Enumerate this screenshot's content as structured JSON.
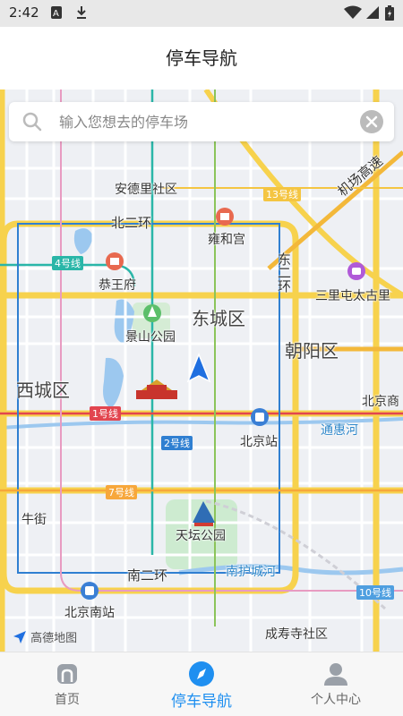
{
  "status_bar": {
    "time": "2:42"
  },
  "header": {
    "title": "停车导航"
  },
  "search": {
    "placeholder": "输入您想去的停车场"
  },
  "map": {
    "attribution": "高德地图",
    "labels": {
      "andeli": "安德里社区",
      "beierhuan": "北二环",
      "yonghegong": "雍和宫",
      "gongwangfu": "恭王府",
      "dongcheng": "东城区",
      "jingshan": "景山公园",
      "xicheng": "西城区",
      "chaoyang": "朝阳区",
      "dongerhuan": "东二环",
      "sanlitun": "三里屯太古里",
      "beijingshang": "北京商",
      "tonghuihe": "通惠河",
      "beijingzhan": "北京站",
      "niujie": "牛街",
      "tiantan": "天坛公园",
      "nanerhuan": "南二环",
      "nanhuchenghe": "南护城河",
      "beijingnan": "北京南站",
      "chengshousi": "成寿寺社区",
      "airport": "机场高速"
    },
    "lines": {
      "line13": "13号线",
      "line4": "4号线",
      "line1": "1号线",
      "line2": "2号线",
      "line7": "7号线",
      "line10": "10号线"
    }
  },
  "tabs": [
    {
      "label": "首页",
      "icon": "home-icon"
    },
    {
      "label": "停车导航",
      "icon": "compass-icon"
    },
    {
      "label": "个人中心",
      "icon": "user-icon"
    }
  ],
  "colors": {
    "accent": "#1f8ff0",
    "subway_line13": "#f4c542",
    "subway_line4": "#2ab6a8",
    "subway_line1": "#e2454f",
    "subway_line2": "#2f7fd1",
    "subway_line7": "#f7a73b",
    "subway_line10": "#4f9fe0",
    "ring_road": "#f7d24d"
  }
}
